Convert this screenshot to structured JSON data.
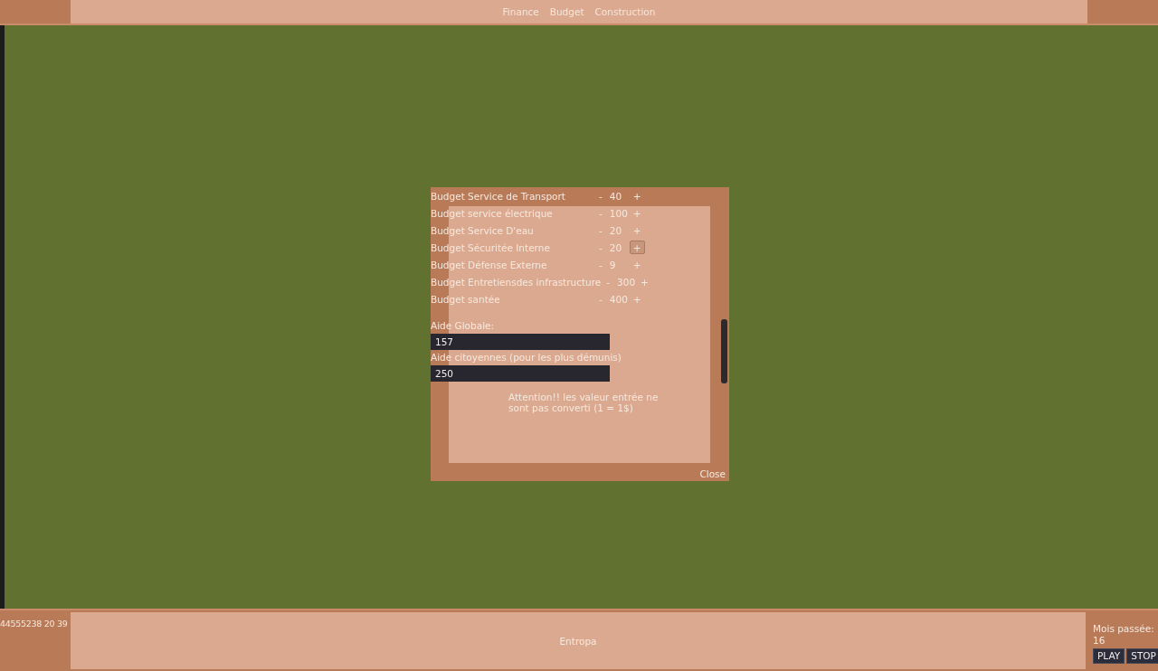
{
  "top_menu": [
    {
      "label": "Finance"
    },
    {
      "label": "Budget"
    },
    {
      "label": "Construction"
    }
  ],
  "dialog": {
    "budgets": [
      {
        "label": "Budget Service de Transport",
        "minus": "-",
        "value": "40",
        "plus": "+",
        "hovered": false
      },
      {
        "label": "Budget service électrique",
        "minus": "-",
        "value": "100",
        "plus": "+",
        "hovered": false
      },
      {
        "label": "Budget Service D'eau",
        "minus": "-",
        "value": "20",
        "plus": "+",
        "hovered": false
      },
      {
        "label": "Budget Sécuritée Interne",
        "minus": "-",
        "value": "20",
        "plus": "+",
        "hovered": true
      },
      {
        "label": "Budget Défense Externe",
        "minus": "-",
        "value": "9",
        "plus": "+",
        "hovered": false
      },
      {
        "label": "Budget Entretiensdes infrastructure",
        "minus": "-",
        "value": "300",
        "plus": "+",
        "hovered": false
      },
      {
        "label": "Budget santée",
        "minus": "-",
        "value": "400",
        "plus": "+",
        "hovered": false
      }
    ],
    "fields": [
      {
        "label": "Aide Globale:",
        "value": "157"
      },
      {
        "label": "Aide citoyennes (pour les plus démunis)",
        "value": "250"
      }
    ],
    "warning": "Attention!! les valeur entrée ne sont pas converti (1 = 1$)",
    "close": "Close"
  },
  "status_bar": {
    "counter": "44555238 20 39",
    "title": "Entropa",
    "months_label": "Mois passée:",
    "months_value": "16",
    "buttons": [
      "PLAY",
      "STOP"
    ]
  }
}
